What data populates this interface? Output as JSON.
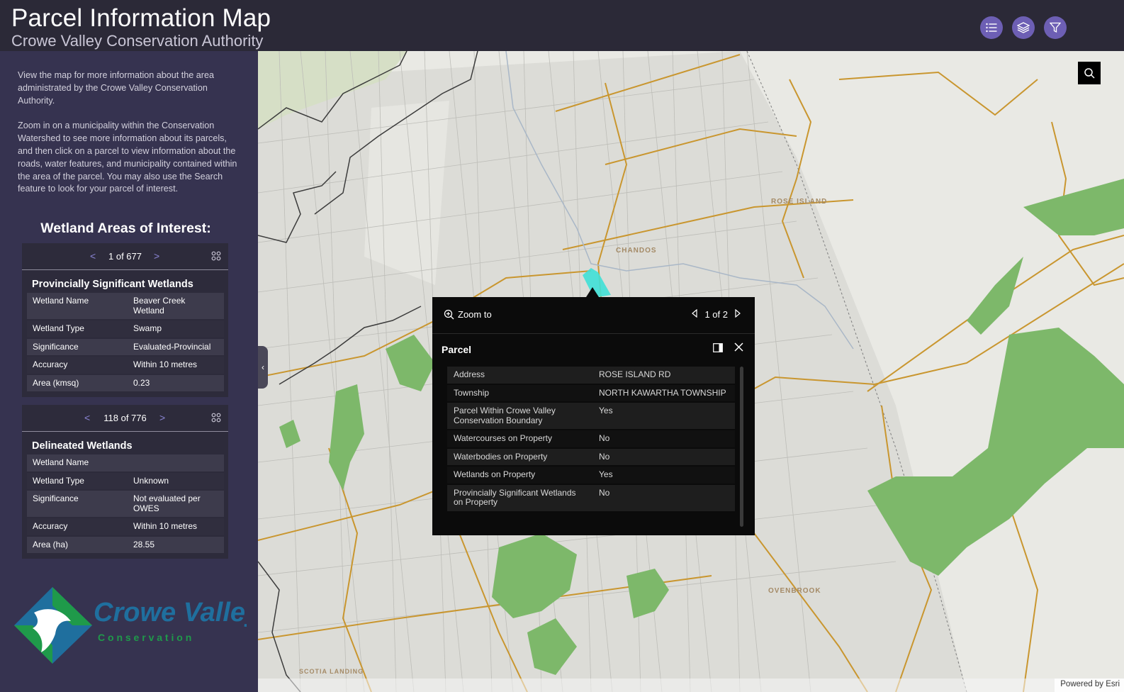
{
  "header": {
    "title": "Parcel Information Map",
    "subtitle": "Crowe Valley Conservation Authority",
    "buttons": [
      "list-icon",
      "layers-icon",
      "filter-icon"
    ],
    "accent": "#6d5fb4",
    "background": "#2b2937"
  },
  "sidebar": {
    "intro_1": "View the map for more information about the area administrated by the Crowe Valley Conservation Authority.",
    "intro_2": "Zoom in on a municipality within the Conservation Watershed to see more information about its parcels, and then click on a parcel to view information about the roads, water features, and municipality contained within the area of the parcel. You may also use the Search feature to look for your parcel of interest.",
    "heading": "Wetland Areas of Interest:",
    "card1": {
      "count": "1 of 677",
      "title": "Provincially Significant Wetlands",
      "rows": [
        {
          "key": "Wetland Name",
          "value": "Beaver Creek Wetland"
        },
        {
          "key": "Wetland Type",
          "value": "Swamp"
        },
        {
          "key": "Significance",
          "value": "Evaluated-Provincial"
        },
        {
          "key": "Accuracy",
          "value": "Within 10 metres"
        },
        {
          "key": "Area (kmsq)",
          "value": "0.23"
        }
      ]
    },
    "card2": {
      "count": "118 of 776",
      "title": "Delineated Wetlands",
      "rows": [
        {
          "key": "Wetland Name",
          "value": ""
        },
        {
          "key": "Wetland Type",
          "value": "Unknown"
        },
        {
          "key": "Significance",
          "value": "Not evaluated per OWES"
        },
        {
          "key": "Accuracy",
          "value": "Within 10 metres"
        },
        {
          "key": "Area (ha)",
          "value": "28.55"
        }
      ]
    },
    "logo": {
      "line1": "Crowe Valley",
      "line2": "C o n s e r v a t i o n",
      "color": "#1f6f9e",
      "green": "#1f9a4a"
    }
  },
  "map": {
    "labels": [
      "ROSE ISLAND",
      "CHANDOS",
      "OVENBROOK",
      "SCOTIA LANDING"
    ],
    "attribution": "Powered by Esri",
    "search_icon": "search-icon",
    "collapse_icon": "chevron-left-icon"
  },
  "popup": {
    "zoom_label": "Zoom to",
    "feature_count": "1 of 2",
    "title": "Parcel",
    "rows": [
      {
        "key": "Address",
        "value": "ROSE ISLAND RD"
      },
      {
        "key": "Township",
        "value": "NORTH KAWARTHA TOWNSHIP"
      },
      {
        "key": "Parcel Within Crowe Valley Conservation Boundary",
        "value": "Yes"
      },
      {
        "key": "Watercourses on Property",
        "value": "No"
      },
      {
        "key": "Waterbodies on Property",
        "value": "No"
      },
      {
        "key": "Wetlands on Property",
        "value": "Yes"
      },
      {
        "key": "Provincially Significant Wetlands on Property",
        "value": "No"
      }
    ]
  }
}
